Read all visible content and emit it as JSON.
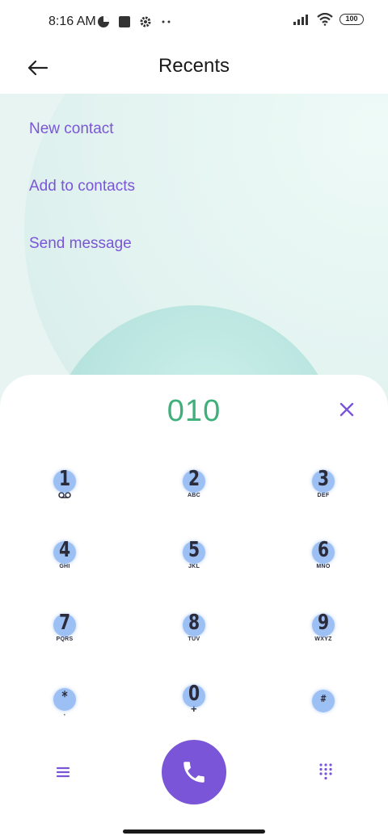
{
  "status_bar": {
    "time": "8:16 AM",
    "battery": "100",
    "icons": [
      "data-saver-icon",
      "square-icon",
      "settings-icon",
      "more-dots-icon",
      "signal-icon",
      "wifi-icon",
      "battery-icon"
    ]
  },
  "header": {
    "title": "Recents",
    "back_icon": "back-arrow-icon"
  },
  "menu": {
    "items": [
      {
        "label": "New contact"
      },
      {
        "label": "Add to contacts"
      },
      {
        "label": "Send message"
      }
    ]
  },
  "dialer": {
    "number": "010",
    "clear_icon": "close-icon",
    "keys": [
      {
        "digit": "1",
        "letters": ""
      },
      {
        "digit": "2",
        "letters": "ABC"
      },
      {
        "digit": "3",
        "letters": "DEF"
      },
      {
        "digit": "4",
        "letters": "GHI"
      },
      {
        "digit": "5",
        "letters": "JKL"
      },
      {
        "digit": "6",
        "letters": "MNO"
      },
      {
        "digit": "7",
        "letters": "PQRS"
      },
      {
        "digit": "8",
        "letters": "TUV"
      },
      {
        "digit": "9",
        "letters": "WXYZ"
      },
      {
        "digit": "*",
        "letters": ","
      },
      {
        "digit": "0",
        "letters": "+"
      },
      {
        "digit": "#",
        "letters": ""
      }
    ],
    "bottom": {
      "menu_icon": "hamburger-menu-icon",
      "call_icon": "phone-icon",
      "keypad_icon": "dialpad-icon"
    }
  },
  "colors": {
    "accent": "#7a55d8",
    "number": "#3fb07b",
    "touch_dot": "#5a96eb"
  }
}
